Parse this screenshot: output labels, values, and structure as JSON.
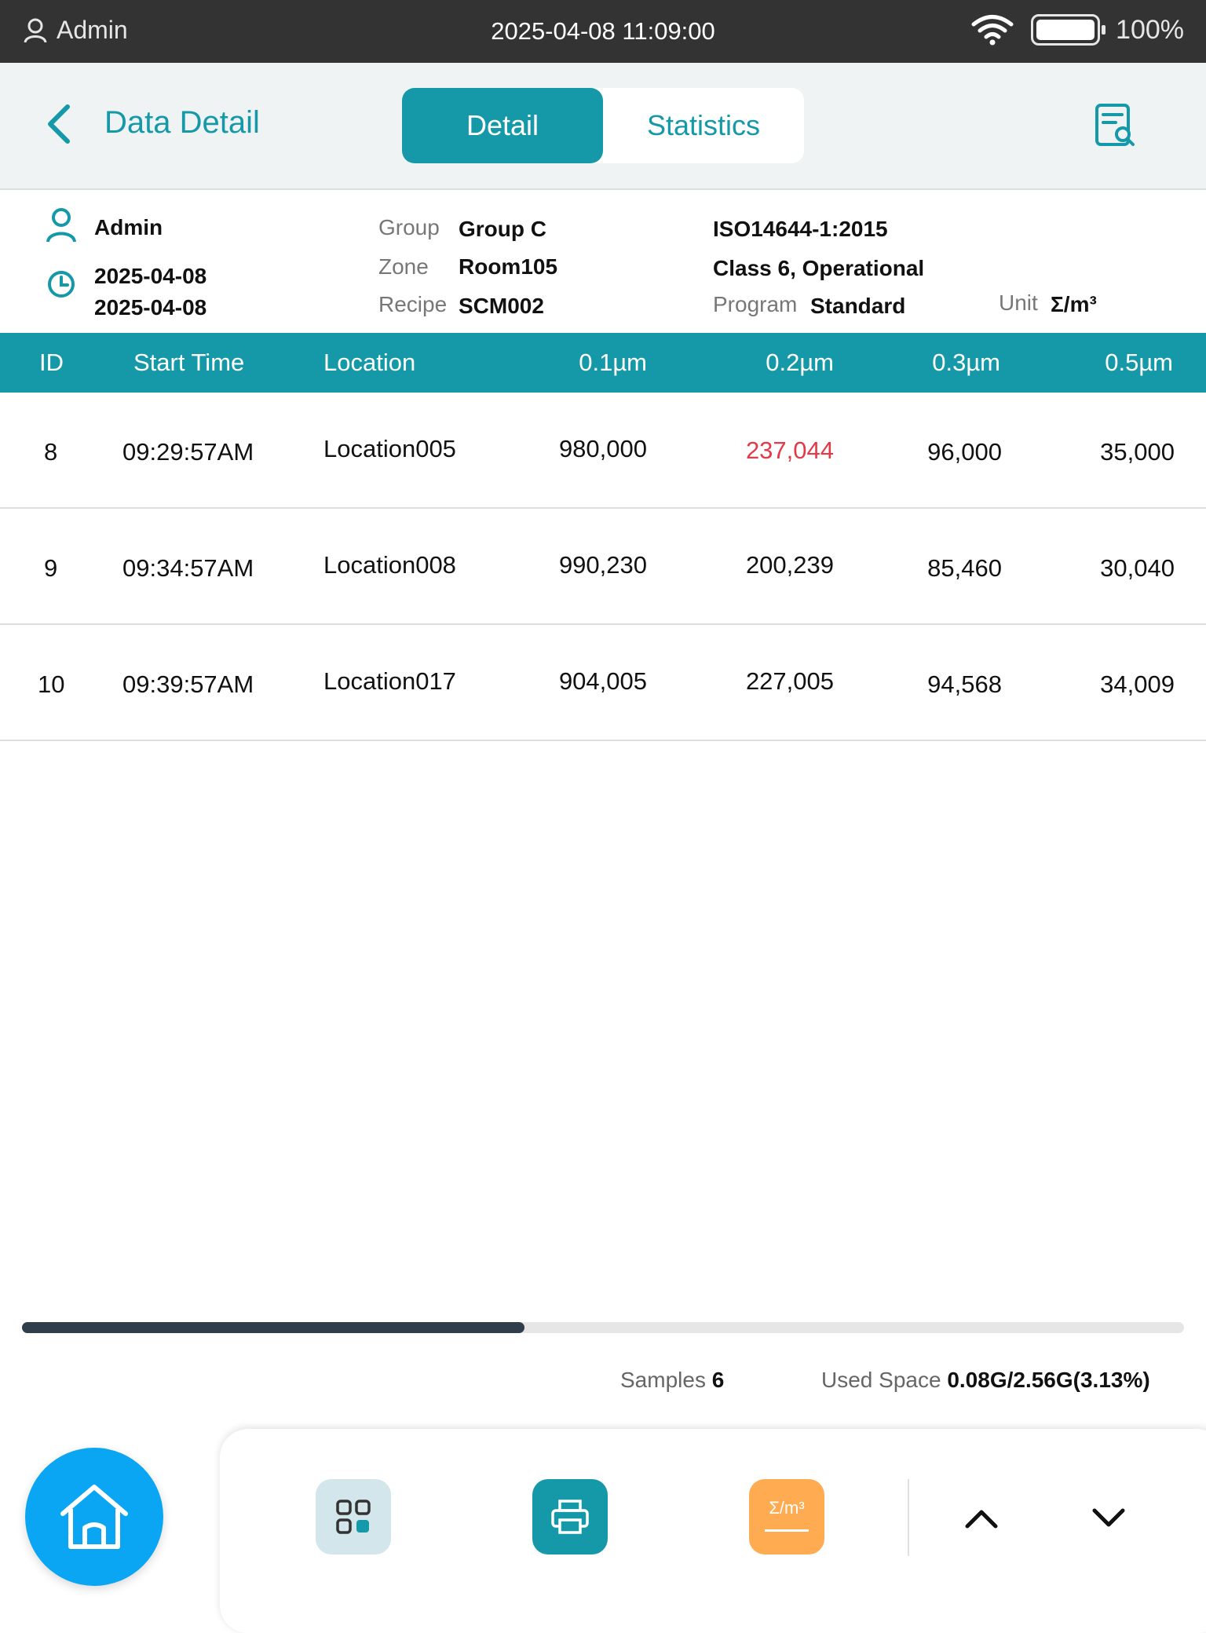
{
  "status_bar": {
    "user": "Admin",
    "datetime": "2025-04-08 11:09:00",
    "battery": "100%"
  },
  "header": {
    "title": "Data Detail",
    "tabs": [
      {
        "label": "Detail",
        "active": true
      },
      {
        "label": "Statistics",
        "active": false
      }
    ]
  },
  "info": {
    "user": "Admin",
    "date_start": "2025-04-08",
    "date_end": "2025-04-08",
    "group_label": "Group",
    "group_value": "Group C",
    "zone_label": "Zone",
    "zone_value": "Room105",
    "recipe_label": "Recipe",
    "recipe_value": "SCM002",
    "standard": "ISO14644-1:2015",
    "class": "Class 6, Operational",
    "program_label": "Program",
    "program_value": "Standard",
    "unit_label": "Unit",
    "unit_value": "Σ/m³"
  },
  "table": {
    "columns": [
      "ID",
      "Start Time",
      "Location",
      "0.1µm",
      "0.2µm",
      "0.3µm",
      "0.5µm"
    ],
    "rows": [
      {
        "id": "8",
        "start": "09:29:57AM",
        "location": "Location005",
        "c01": "980,000",
        "c02": "237,044",
        "c03": "96,000",
        "c05": "35,000",
        "c02_exceeded": true
      },
      {
        "id": "9",
        "start": "09:34:57AM",
        "location": "Location008",
        "c01": "990,230",
        "c02": "200,239",
        "c03": "85,460",
        "c05": "30,040",
        "c02_exceeded": false
      },
      {
        "id": "10",
        "start": "09:39:57AM",
        "location": "Location017",
        "c01": "904,005",
        "c02": "227,005",
        "c03": "94,568",
        "c05": "34,009",
        "c02_exceeded": false
      }
    ]
  },
  "scroll": {
    "position_fraction": 0.43
  },
  "footer": {
    "samples_label": "Samples",
    "samples_value": "6",
    "space_label": "Used Space",
    "space_value": "0.08G/2.56G(3.13%)"
  },
  "toolbar": {
    "unit_button_label": "Σ/m³"
  },
  "colors": {
    "accent": "#1599a8",
    "exceeded": "#e23a48",
    "home": "#0aa6f4",
    "unit_button": "#ffab52"
  },
  "icons": [
    "user-icon",
    "wifi-icon",
    "battery-icon",
    "back-chevron-icon",
    "report-search-icon",
    "clock-icon",
    "home-icon",
    "grid-icon",
    "printer-icon",
    "chevron-up-icon",
    "chevron-down-icon"
  ]
}
